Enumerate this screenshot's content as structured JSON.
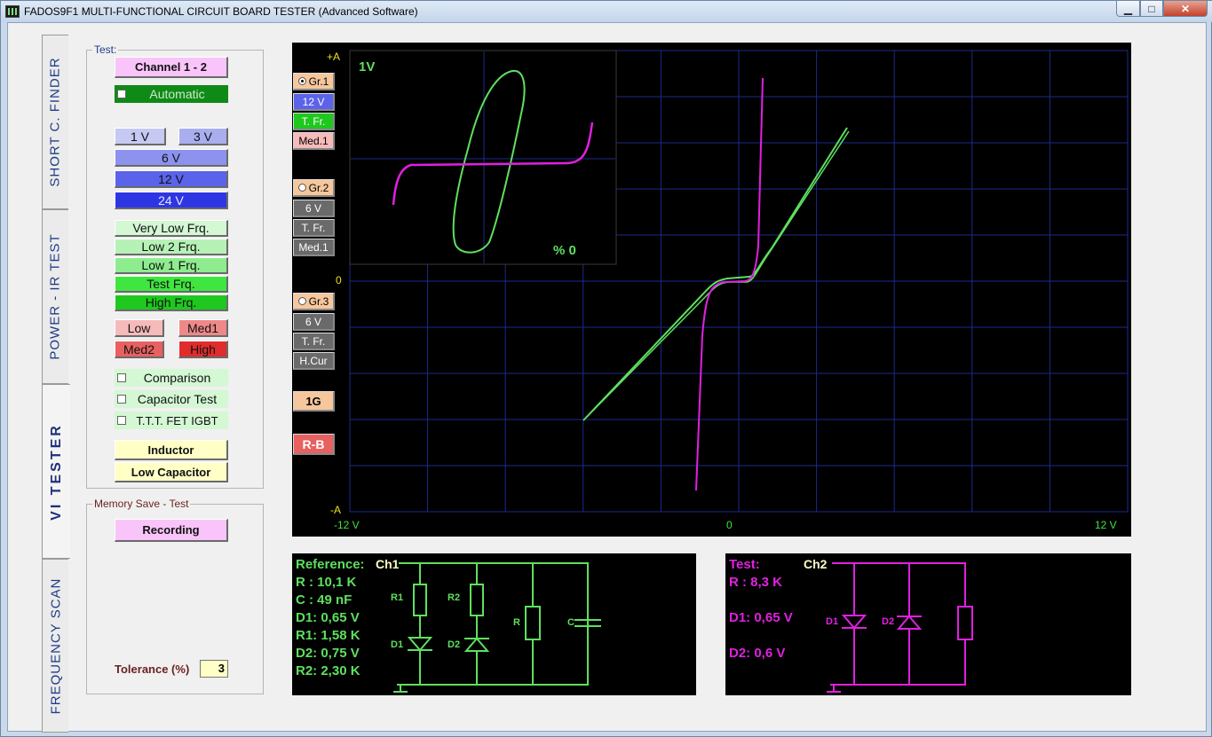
{
  "window": {
    "title": "FADOS9F1  MULTI-FUNCTIONAL  CIRCUIT  BOARD  TESTER (Advanced Software)",
    "minimize": "▁",
    "maximize": "□",
    "close": "✕"
  },
  "tabs": [
    "SHORT  C. FINDER",
    "POWER - IR TEST",
    "VI  TESTER",
    "FREQUENCY SCAN"
  ],
  "test_group": {
    "title": "Test:",
    "channel_button": "Channel 1 - 2",
    "automatic": "Automatic",
    "voltage_buttons": [
      "1 V",
      "3 V",
      "6 V",
      "12 V",
      "24 V"
    ],
    "frequency_buttons": [
      "Very Low Frq.",
      "Low 2 Frq.",
      "Low 1 Frq.",
      "Test Frq.",
      "High Frq."
    ],
    "current_buttons": [
      "Low",
      "Med1",
      "Med2",
      "High"
    ],
    "checks": [
      "Comparison",
      "Capacitor Test",
      "T.T.T. FET  IGBT"
    ],
    "inductor": "Inductor",
    "low_capacitor": "Low Capacitor"
  },
  "memory_group": {
    "title": "Memory Save - Test",
    "recording": "Recording",
    "tolerance_label": "Tolerance (%)",
    "tolerance_value": "3"
  },
  "scope": {
    "y_top": "+A",
    "y_mid": "0",
    "y_bottom": "-A",
    "x_left": "-12 V",
    "x_mid": "0",
    "x_right": "12 V",
    "inset_voltage": "1V",
    "inset_percent": "% 0",
    "groups": [
      {
        "name": "Gr.1",
        "voltage": "12 V",
        "freq": "T. Fr.",
        "current": "Med.1",
        "selected": true
      },
      {
        "name": "Gr.2",
        "voltage": "6 V",
        "freq": "T. Fr.",
        "current": "Med.1",
        "selected": false
      },
      {
        "name": "Gr.3",
        "voltage": "6 V",
        "freq": "T. Fr.",
        "current": "H.Cur",
        "selected": false
      }
    ],
    "btn_1g": "1G",
    "btn_rb": "R-B",
    "colors": {
      "reference": "#5ee05e",
      "test": "#e020e0",
      "grid": "#1c2a8c"
    }
  },
  "reference_panel": {
    "title": "Reference:",
    "channel": "Ch1",
    "lines": [
      "R : 10,1 K",
      "C : 49 nF",
      "D1: 0,65 V",
      "R1: 1,58 K",
      "D2: 0,75 V",
      "R2: 2,30 K"
    ],
    "labels": {
      "r1": "R1",
      "r2": "R2",
      "r": "R",
      "c": "C",
      "d1": "D1",
      "d2": "D2"
    }
  },
  "test_panel": {
    "title": "Test:",
    "channel": "Ch2",
    "lines": [
      "R : 8,3 K",
      "D1: 0,65 V",
      "D2: 0,6 V"
    ],
    "labels": {
      "d1": "D1",
      "d2": "D2"
    }
  }
}
